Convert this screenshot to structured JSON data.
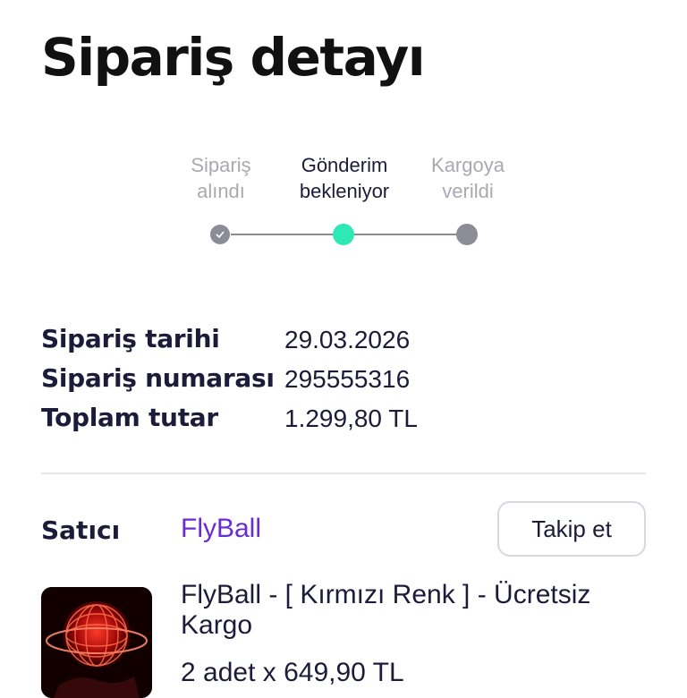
{
  "header": {
    "title": "Sipariş detayı"
  },
  "stepper": {
    "steps": [
      {
        "line1": "Sipariş",
        "line2": "alındı",
        "state": "completed"
      },
      {
        "line1": "Gönderim",
        "line2": "bekleniyor",
        "state": "current"
      },
      {
        "line1": "Kargoya",
        "line2": "verildi",
        "state": "pending"
      }
    ],
    "colors": {
      "current": "#2ee8b6",
      "inactive": "#8c8c96"
    }
  },
  "order": {
    "date_label": "Sipariş tarihi",
    "date_value": "29.03.2026",
    "number_label": "Sipariş numarası",
    "number_value": "295555316",
    "total_label": "Toplam tutar",
    "total_value": "1.299,80 TL"
  },
  "seller": {
    "label": "Satıcı",
    "name": "FlyBall",
    "follow_label": "Takip et",
    "name_color": "#6a2bd4"
  },
  "product": {
    "name": "FlyBall - [ Kırmızı Renk ] - Ücretsiz Kargo",
    "quantity_price": "2 adet x 649,90 TL",
    "image_icon": "red-glowing-orb-ball"
  }
}
